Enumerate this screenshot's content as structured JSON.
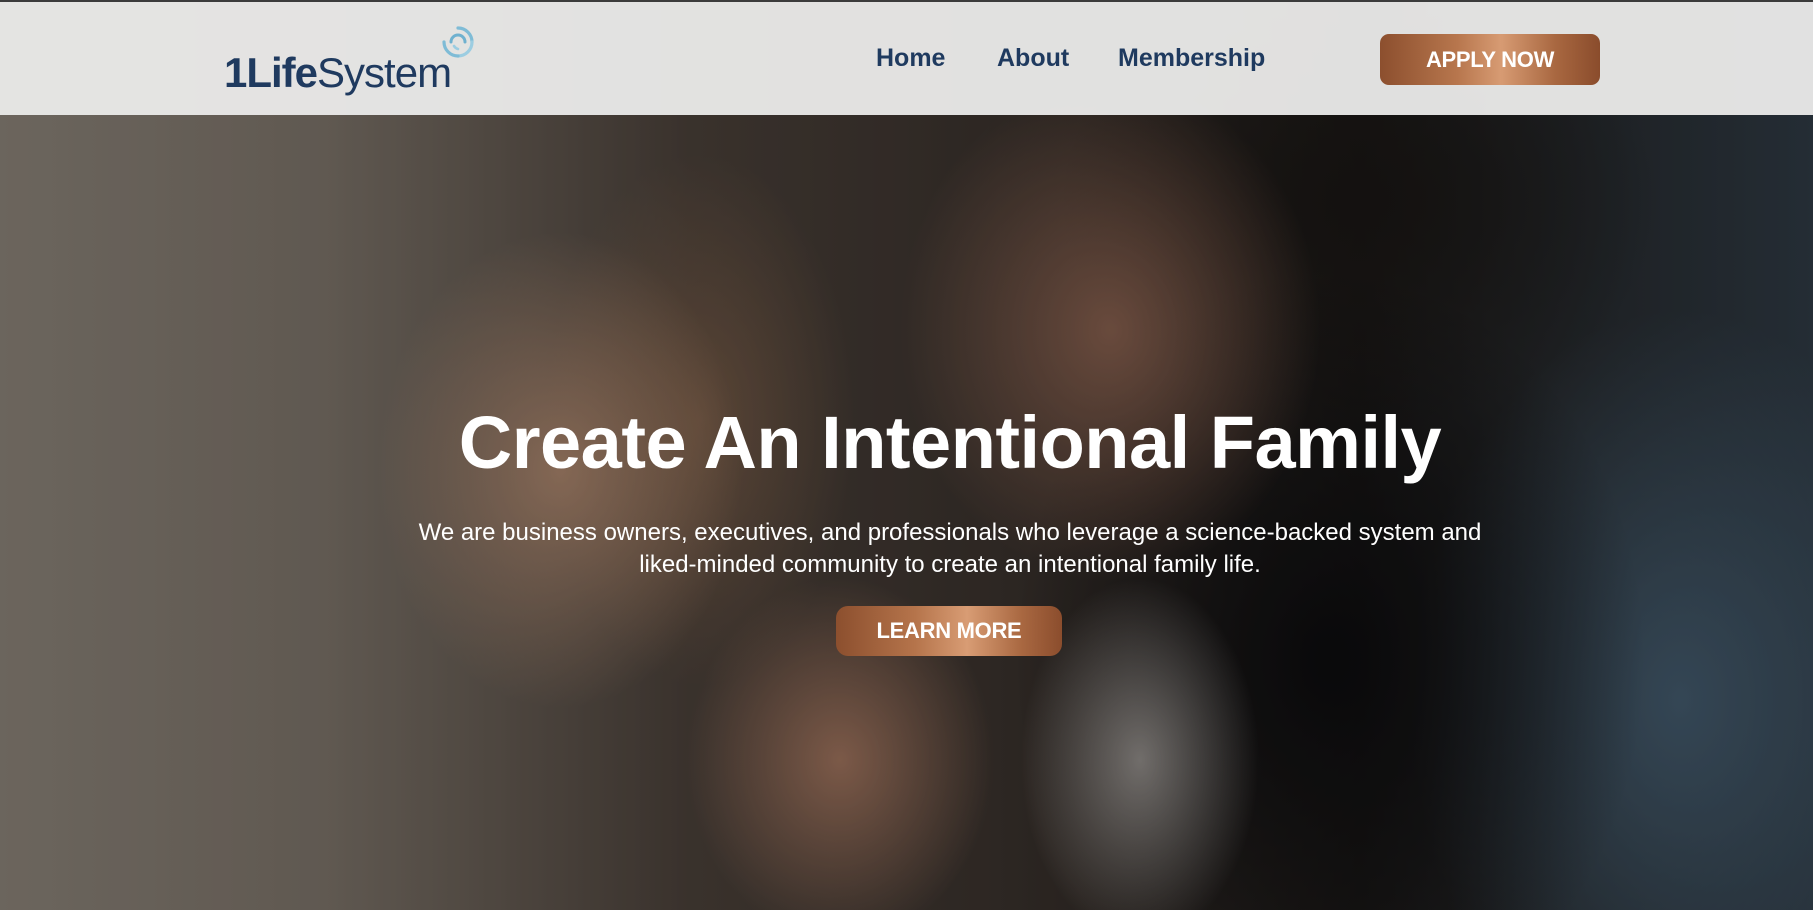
{
  "header": {
    "logo": {
      "text_bold": "1Life",
      "text_light": "System",
      "icon": "swirl-logo-icon",
      "color": "#1f3a5f",
      "icon_color": "#7fbcd6"
    },
    "nav": {
      "home": "Home",
      "about": "About",
      "membership": "Membership"
    },
    "apply_label": "APPLY NOW"
  },
  "hero": {
    "title": "Create An Intentional Family",
    "subtitle_line1": "We are business owners, executives, and professionals who leverage a science-backed system and",
    "subtitle_line2": "liked-minded community to create an intentional family life.",
    "cta_label": "LEARN MORE",
    "background": "photo-couple-listening"
  },
  "colors": {
    "nav_text": "#1f3a5f",
    "header_bg": "#e9e9e8",
    "button_copper": "#b7764d",
    "hero_text": "#ffffff"
  }
}
